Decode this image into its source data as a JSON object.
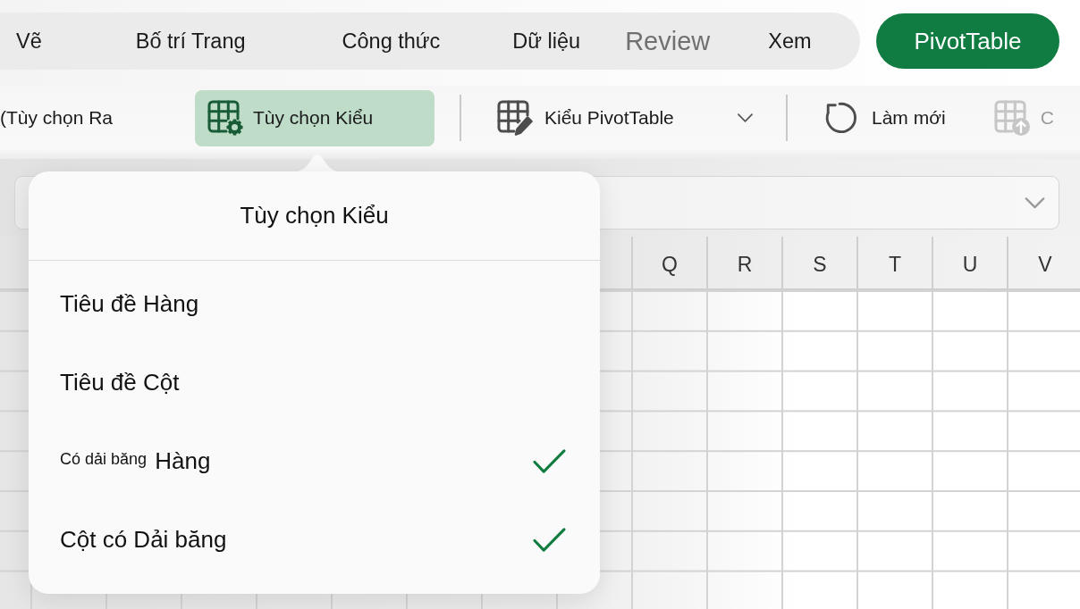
{
  "ribbon_tabs": [
    {
      "label": "Vẽ",
      "selected": false,
      "dimmed": false
    },
    {
      "label": "Bố trí Trang",
      "selected": false,
      "dimmed": false
    },
    {
      "label": "Công thức",
      "selected": false,
      "dimmed": false
    },
    {
      "label": "Dữ liệu",
      "selected": false,
      "dimmed": false
    },
    {
      "label": "Review",
      "selected": false,
      "dimmed": true
    },
    {
      "label": "Xem",
      "selected": false,
      "dimmed": false
    },
    {
      "label": "PivotTable",
      "selected": true,
      "dimmed": false
    }
  ],
  "toolbar": [
    {
      "kind": "button",
      "label": "(Tùy chọn Ra",
      "selected": false,
      "disabled": false
    },
    {
      "kind": "button",
      "label": "Tùy chọn Kiểu",
      "selected": true,
      "disabled": false
    },
    {
      "kind": "dropdown",
      "label": "Kiểu PivotTable",
      "selected": false,
      "disabled": false
    },
    {
      "kind": "button",
      "label": "Làm mới",
      "selected": false,
      "disabled": false
    },
    {
      "kind": "button",
      "label": "C",
      "selected": false,
      "disabled": true
    }
  ],
  "sheet": {
    "columns": [
      "Q",
      "R",
      "S",
      "T",
      "U",
      "V"
    ]
  },
  "popover": {
    "title": "Tùy chọn Kiểu",
    "items": [
      {
        "label": "Tiêu đề Hàng",
        "checked": false
      },
      {
        "label": "Tiêu đề Cột",
        "checked": false
      },
      {
        "label": "$^{Có dải băng}$ Hàng",
        "checked": true
      },
      {
        "label": "Cột có Dải băng",
        "checked": true
      }
    ]
  }
}
